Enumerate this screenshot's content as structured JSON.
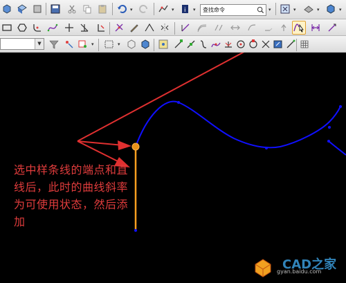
{
  "toolbar": {
    "search_placeholder": "查找命令"
  },
  "annotation": {
    "text": "选中样条线的端点和直线后，此时的曲线斜率为可使用状态，然后添加"
  },
  "watermark": {
    "brand": "CAD之家",
    "site": "gyan.baidu.com"
  },
  "colors": {
    "spline": "#1010ff",
    "line": "#ffa020",
    "arrow": "#e03030",
    "annotation": "#e03c3c",
    "canvas": "#000000",
    "highlight": "#fff3c8"
  }
}
